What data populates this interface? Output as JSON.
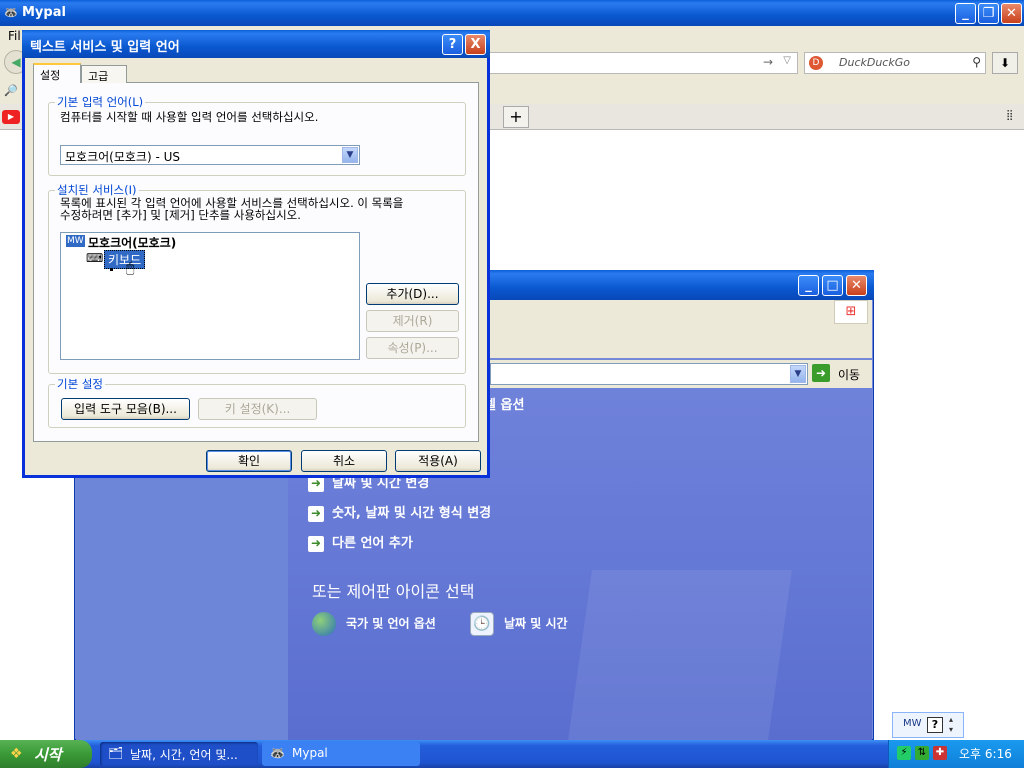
{
  "browser": {
    "title": "Mypal",
    "menu_first": "Fil",
    "search_placeholder": "DuckDuckGo",
    "search_engine_icon": "duckduckgo-icon",
    "new_tab": "+",
    "tab_close": "x"
  },
  "control_panel": {
    "go_label": "이동",
    "partial_heading": "렐 옵션",
    "tasks": [
      "날짜 및 시간 변경",
      "숫자, 날짜 및 시간 형식 변경",
      "다른 언어 추가"
    ],
    "icon_heading": "또는 제어판 아이콘 선택",
    "icons": [
      {
        "label": "국가 및 언어 옵션",
        "icon": "globe-icon"
      },
      {
        "label": "날짜 및 시간",
        "icon": "clock-calendar-icon"
      }
    ]
  },
  "dialog": {
    "title": "텍스트 서비스 및 입력 언어",
    "help": "?",
    "close": "X",
    "tabs": [
      "설정",
      "고급"
    ],
    "default_lang": {
      "legend": "기본 입력 언어(L)",
      "desc": "컴퓨터를 시작할 때 사용할 입력 언어를 선택하십시오.",
      "selected": "모호크어(모호크) - US"
    },
    "installed": {
      "legend": "설치된 서비스(I)",
      "desc_line1": "목록에 표시된 각 입력 언어에 사용할 서비스를 선택하십시오. 이 목록을",
      "desc_line2": "수정하려면 [추가] 및 [제거] 단추를 사용하십시오.",
      "lang_code": "MW",
      "language": "모호크어(모호크)",
      "category": "키보드",
      "add": "추가(D)...",
      "remove": "제거(R)",
      "properties": "속성(P)..."
    },
    "prefs": {
      "legend": "기본 설정",
      "language_bar": "입력 도구 모음(B)...",
      "key_settings": "키 설정(K)..."
    },
    "ok": "확인",
    "cancel": "취소",
    "apply": "적용(A)"
  },
  "taskbar": {
    "start": "시작",
    "tasks": [
      {
        "label": "날짜, 시간, 언어 및...",
        "icon": "control-panel-icon"
      },
      {
        "label": "Mypal",
        "icon": "mypal-icon"
      }
    ],
    "time": "오후 6:16",
    "lang_code": "MW",
    "help": "?"
  },
  "colors": {
    "xp_title": "#0a58d0",
    "cp_background": "#6f82da",
    "taskbar": "#245edb",
    "start": "#3a9a36"
  }
}
